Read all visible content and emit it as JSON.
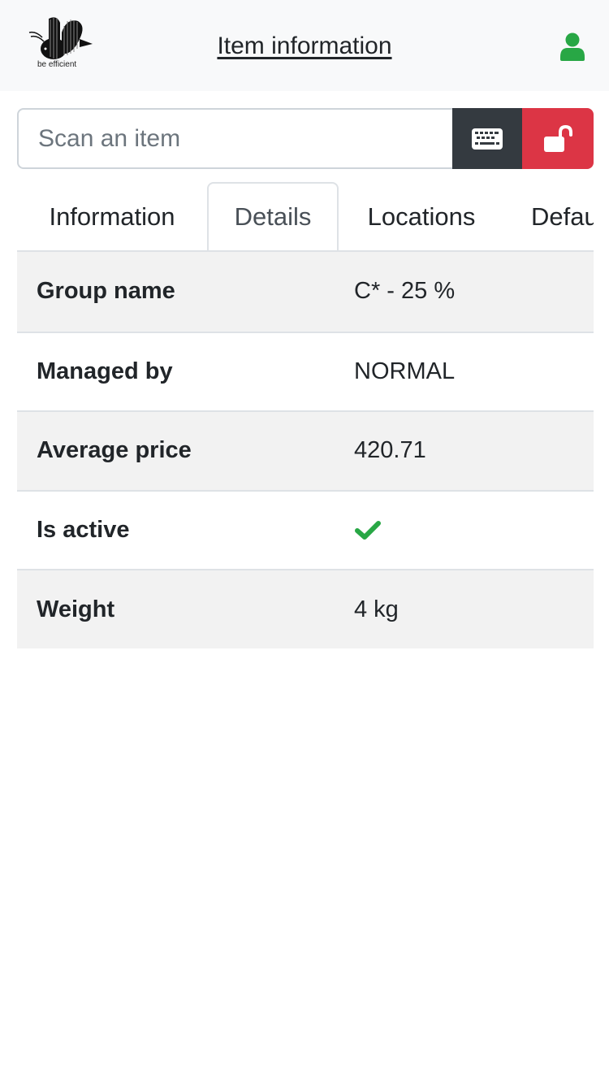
{
  "header": {
    "logo_text": "be efficient",
    "title": "Item information",
    "user_icon": "user-icon",
    "user_icon_color": "#28a745"
  },
  "scan": {
    "placeholder": "Scan an item",
    "value": "",
    "keyboard_icon": "keyboard-icon",
    "lock_icon": "unlock-icon",
    "keyboard_button_color": "#343a40",
    "lock_button_color": "#dc3545"
  },
  "tabs": [
    {
      "label": "Information",
      "active": false
    },
    {
      "label": "Details",
      "active": true
    },
    {
      "label": "Locations",
      "active": false
    },
    {
      "label": "Defau",
      "active": false
    }
  ],
  "details": [
    {
      "label": "Group name",
      "value": "C* - 25 %"
    },
    {
      "label": "Managed by",
      "value": "NORMAL"
    },
    {
      "label": "Average price",
      "value": "420.71"
    },
    {
      "label": "Is active",
      "value": "",
      "icon": "check-icon",
      "icon_color": "#28a745"
    },
    {
      "label": "Weight",
      "value": "4 kg"
    }
  ]
}
